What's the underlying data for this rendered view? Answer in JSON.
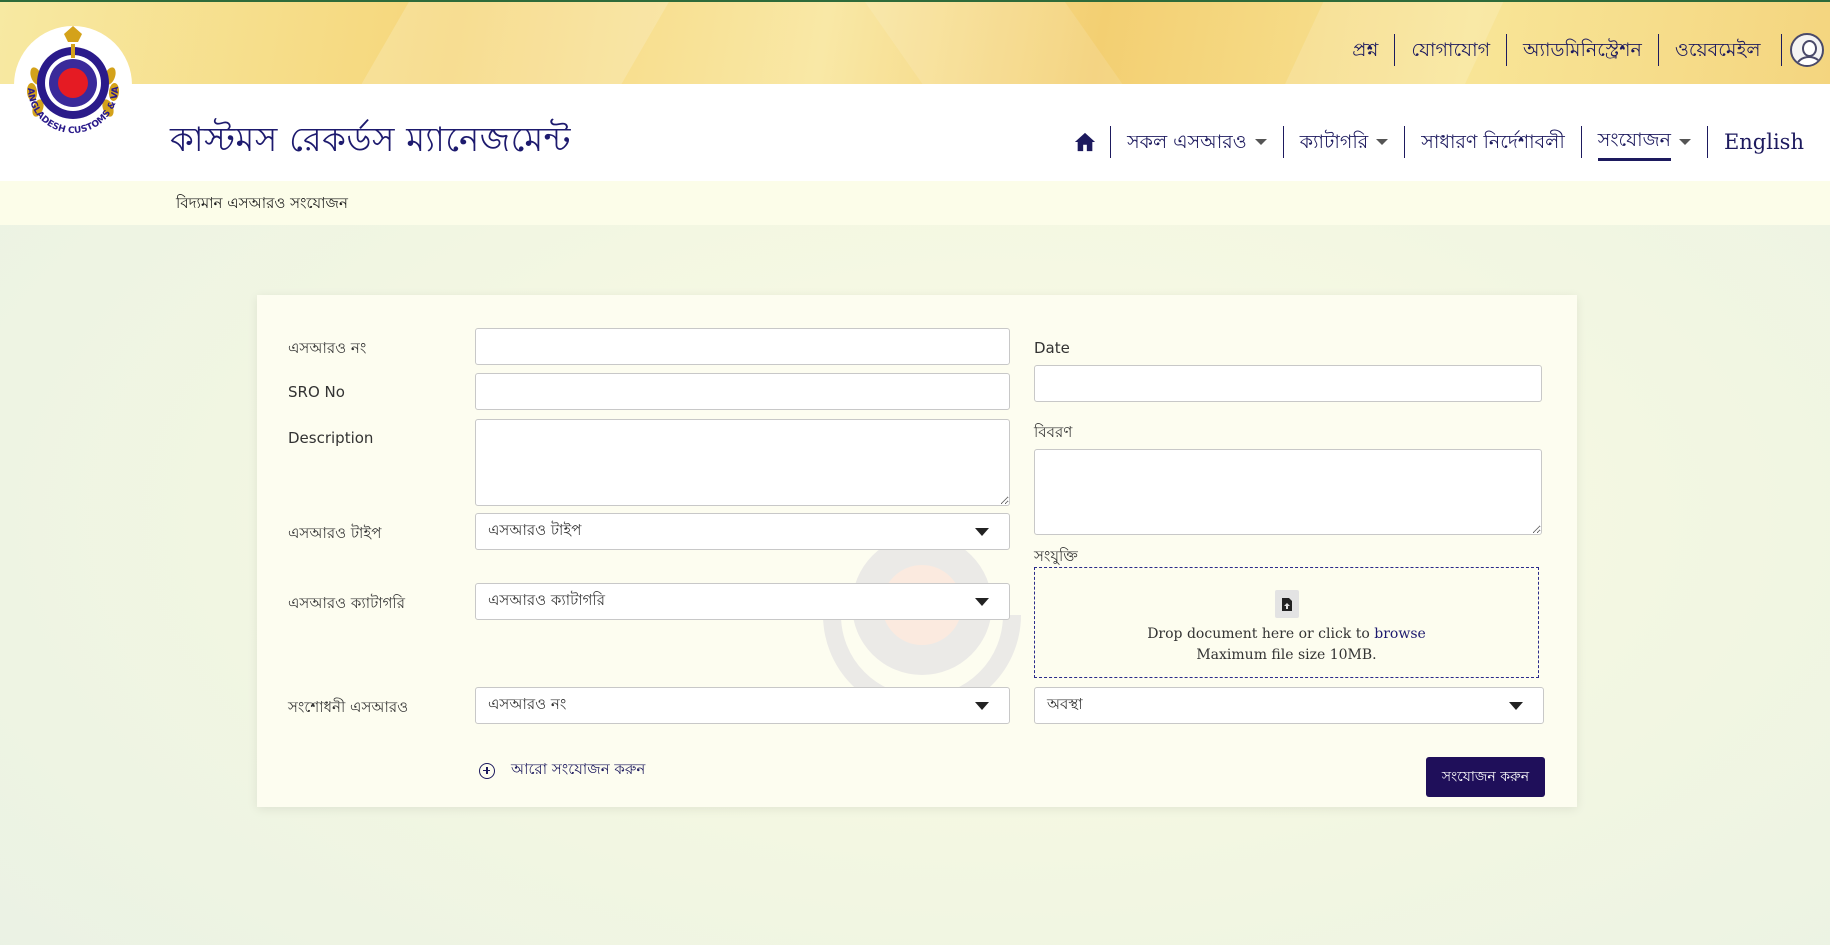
{
  "top_links": [
    "প্রশ্ন",
    "যোগাযোগ",
    "অ্যাডমিনিস্ট্রেশন",
    "ওয়েবমেইল"
  ],
  "logo_text": "BANGLADESH CUSTOMS & VAT",
  "site_title": "কাস্টমস রেকর্ডস ম্যানেজমেন্ট",
  "nav": {
    "home_icon": "home-icon",
    "items": [
      {
        "label": "সকল এসআরও",
        "dropdown": true
      },
      {
        "label": "ক্যাটাগরি",
        "dropdown": true
      },
      {
        "label": "সাধারণ নির্দেশাবলী",
        "dropdown": false
      },
      {
        "label": "সংযোজন",
        "dropdown": true,
        "active": true
      }
    ],
    "language": "English"
  },
  "breadcrumb": "বিদ্যমান এসআরও সংযোজন",
  "form": {
    "sro_no_bn_label": "এসআরও নং",
    "sro_no_label": "SRO No",
    "description_label": "Description",
    "sro_type_label": "এসআরও টাইপ",
    "sro_type_value": "এসআরও টাইপ",
    "sro_category_label": "এসআরও ক্যাটাগরি",
    "sro_category_value": "এসআরও ক্যাটাগরি",
    "amended_sro_label": "সংশোধনী এসআরও",
    "amended_sro_value": "এসআরও নং",
    "date_label": "Date",
    "bibaron_label": "বিবরণ",
    "attachment_label": "সংযুক্তি",
    "dropzone_text": "Drop document here or click to",
    "dropzone_browse": "browse",
    "dropzone_max": "Maximum file size 10MB.",
    "status_value": "অবস্থা",
    "add_more_label": "আরো সংযোজন করুন",
    "submit_label": "সংযোজন করুন"
  },
  "colors": {
    "primary": "#1f0f5a",
    "nav_text": "#1d1a5e",
    "top_band": "#f6d67a",
    "card_bg": "#fdfdf0"
  }
}
